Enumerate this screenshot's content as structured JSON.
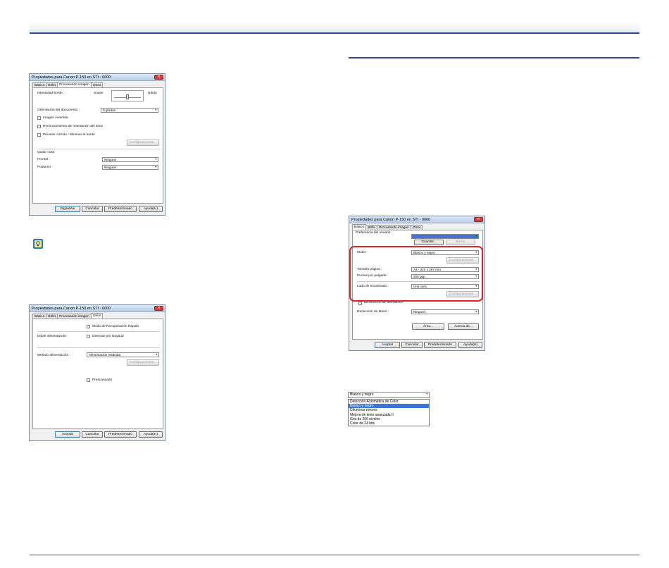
{
  "dialog1": {
    "title": "Propiedades para Canon P-150 en STI - 0000",
    "tabs": [
      "Básico",
      "Brillo",
      "Procesando imagen",
      "Otros"
    ],
    "intensity_label": "Intensidad borde :",
    "soft_label": "Suave",
    "sharp_label": "Nítido",
    "orientation_label": "Orientación del documento :",
    "orientation_value": "0 grados",
    "checks": [
      "Imagen invertida",
      "Reconocimiento de orientación del texto",
      "Prevenir corrido / Eliminar el borde"
    ],
    "settings_button": "Configuraciones...",
    "dropout_label": "Quitar color",
    "front_label": "Frontal :",
    "front_value": "Ninguno",
    "back_label": "Posterior :",
    "back_value": "Ninguno",
    "buttons": [
      "Digitalizar",
      "Cancelar",
      "Predeterminado",
      "Ayuda(H)"
    ]
  },
  "dialog2": {
    "title": "Propiedades para Canon P-150 en STI - 0000",
    "tabs": [
      "Básico",
      "Brillo",
      "Procesando imagen",
      "Otros"
    ],
    "rapid_recovery": "Modo de Recuperación Rápido",
    "double_feed_label": "Doble alimentación :",
    "length_detect": "Detectar por longitud",
    "feed_method_label": "Método alimentación :",
    "feed_method_value": "Alimentación estándar",
    "settings_button": "Configuraciones...",
    "prescan": "Prescaneado",
    "buttons": [
      "Aceptar",
      "Cancelar",
      "Predeterminado",
      "Ayuda(H)"
    ]
  },
  "dialog3": {
    "title": "Propiedades para Canon P-150 en STI - 0000",
    "tabs": [
      "Básico",
      "Brillo",
      "Procesando imagen",
      "Otros"
    ],
    "user_pref_label": "Preferencia del usuario :",
    "save_button": "Guardar...",
    "delete_button": "Borrar",
    "mode_label": "Modo :",
    "mode_value": "Blanco y negro",
    "settings_button": "Configuraciones...",
    "page_size_label": "Tamaño página :",
    "page_size_value": "A4 - 210 x 297 mm",
    "dpi_label": "Puntos por pulgada :",
    "dpi_value": "200 ppp",
    "scan_side_label": "Lado de escaneado :",
    "scan_side_value": "Una cara",
    "settings_button_2": "Configuraciones...",
    "deskew": "Eliminación de desviación",
    "moire_label": "Reducción de Moiré :",
    "moire_value": "Ninguno",
    "area_button": "Área...",
    "about_button": "Acerca de...",
    "buttons": [
      "Aceptar",
      "Cancelar",
      "Predeterminado",
      "Ayuda(H)"
    ]
  },
  "mode_dropdown": {
    "selected": "Blanco y negro",
    "options": [
      "Detección Automática de Color",
      "Blanco y negro",
      "Difuminar errores",
      "Mejora de texto avanzada II",
      "Gris de 256 niveles",
      "Color de 24 bits"
    ],
    "highlighted_index": 1
  },
  "colors": {
    "rule_blue": "#2b4c8c",
    "highlight_red": "#d9262b",
    "selection_blue": "#3a78d6"
  }
}
